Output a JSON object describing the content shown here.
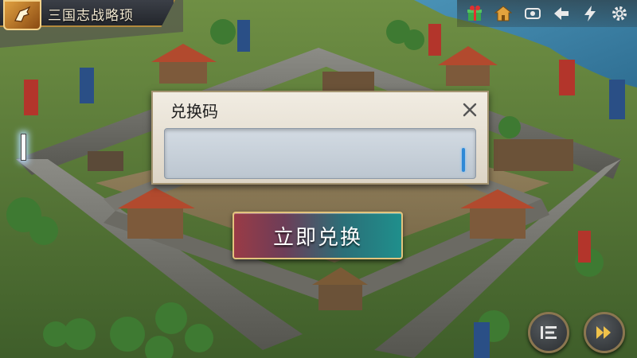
{
  "header": {
    "title": "三国志战略顼"
  },
  "top_icons": [
    {
      "name": "gift-icon"
    },
    {
      "name": "home-icon"
    },
    {
      "name": "eye-icon"
    },
    {
      "name": "back-arrow-icon"
    },
    {
      "name": "lightning-icon"
    },
    {
      "name": "gear-icon"
    }
  ],
  "redeem_dialog": {
    "title": "兑换码",
    "input_value": "",
    "button_label": "立即兑换"
  },
  "controls": {
    "log_icon": "log-list-icon",
    "fast_forward_icon": "fast-forward-icon"
  },
  "colors": {
    "dialog_bg": "#ece6da",
    "button_left": "#9a3b46",
    "button_right": "#1f8f8c",
    "button_border": "#e3c47d",
    "title_plate": "#2e3137"
  }
}
